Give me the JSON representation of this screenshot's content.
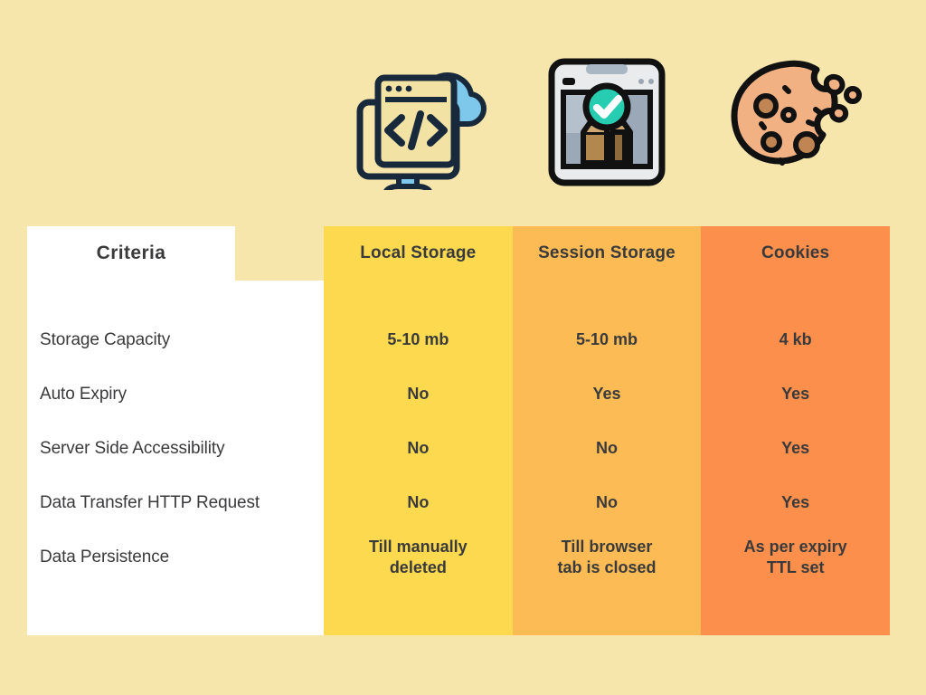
{
  "page": {
    "background_color": "#f6e6ab",
    "text_color": "#3a3a3c"
  },
  "icons": [
    {
      "name": "monitor-code-cloud-icon",
      "for_column": "Local Storage"
    },
    {
      "name": "browser-box-check-icon",
      "for_column": "Session Storage"
    },
    {
      "name": "cookie-bitten-icon",
      "for_column": "Cookies"
    }
  ],
  "table": {
    "criteria_header": "Criteria",
    "column_headers": [
      "Local Storage",
      "Session Storage",
      "Cookies"
    ],
    "column_colors": [
      "#fcd94f",
      "#fcbb54",
      "#fc8f4c"
    ],
    "criteria_column_color": "#ffffff",
    "rows": [
      {
        "criteria": "Storage Capacity",
        "values": [
          "5-10 mb",
          "5-10 mb",
          "4 kb"
        ]
      },
      {
        "criteria": "Auto Expiry",
        "values": [
          "No",
          "Yes",
          "Yes"
        ]
      },
      {
        "criteria": "Server Side Accessibility",
        "values": [
          "No",
          "No",
          "Yes"
        ]
      },
      {
        "criteria": "Data Transfer HTTP Request",
        "values": [
          "No",
          "No",
          "Yes"
        ]
      },
      {
        "criteria": "Data Persistence",
        "values": [
          "Till manually\ndeleted",
          "Till browser\ntab is closed",
          "As per expiry\nTTL set"
        ]
      }
    ]
  }
}
